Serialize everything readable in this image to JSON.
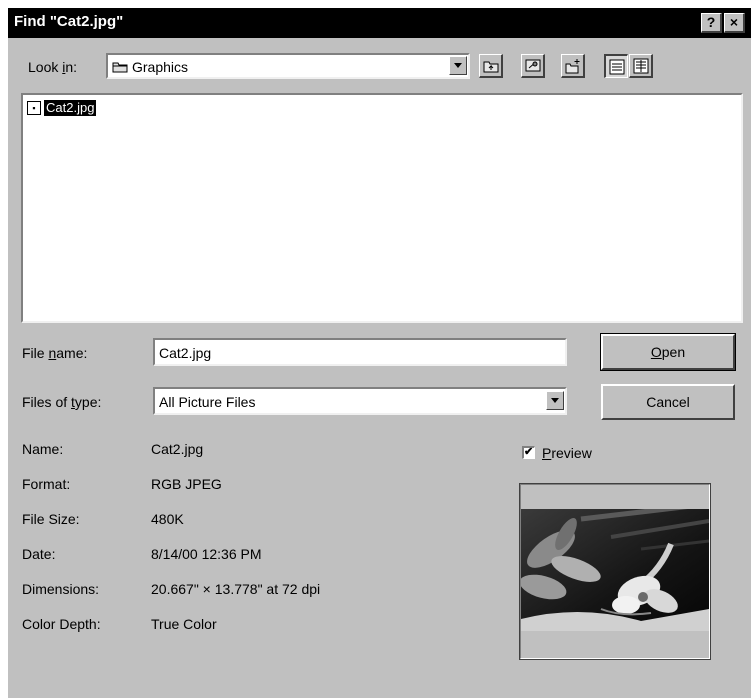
{
  "window": {
    "title": "Find \"Cat2.jpg\"",
    "help_button": "?",
    "close_button": "×"
  },
  "look_in": {
    "label_pre": "Look ",
    "label_hotkey": "i",
    "label_post": "n:",
    "value": "Graphics"
  },
  "toolbar": {
    "buttons": [
      "up-folder",
      "desktop",
      "new-folder",
      "list-view",
      "details-view"
    ]
  },
  "file_list": {
    "items": [
      {
        "name": "Cat2.jpg",
        "selected": true
      }
    ]
  },
  "file_name": {
    "label_pre": "File ",
    "label_hotkey": "n",
    "label_post": "ame:",
    "value": "Cat2.jpg"
  },
  "file_type": {
    "label_pre": "Files of ",
    "label_hotkey": "t",
    "label_post": "ype:",
    "value": "All Picture Files"
  },
  "buttons": {
    "open_hotkey": "O",
    "open_rest": "pen",
    "cancel": "Cancel"
  },
  "info": [
    {
      "label": "Name:",
      "value": "Cat2.jpg"
    },
    {
      "label": "Format:",
      "value": "RGB JPEG"
    },
    {
      "label": "File Size:",
      "value": "480K"
    },
    {
      "label": "Date:",
      "value": "8/14/00 12:36 PM"
    },
    {
      "label": "Dimensions:",
      "value": "20.667\" × 13.778\" at 72 dpi"
    },
    {
      "label": "Color Depth:",
      "value": "True Color"
    }
  ],
  "preview": {
    "checked": true,
    "check_mark": "✔",
    "label_hotkey": "P",
    "label_rest": "review"
  },
  "colors": {
    "dialog_bg": "#c0c0c0",
    "titlebar": "#000000",
    "selection": "#000000"
  }
}
